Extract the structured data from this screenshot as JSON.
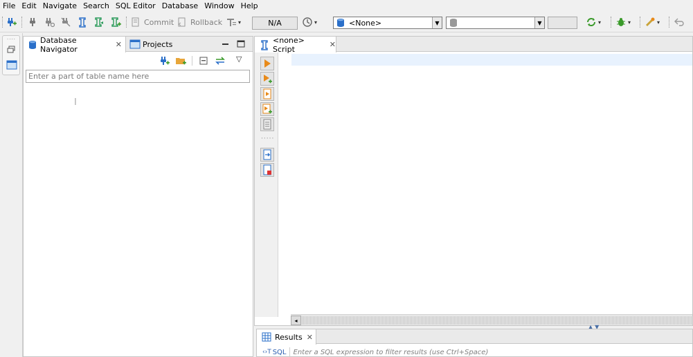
{
  "menu": [
    "File",
    "Edit",
    "Navigate",
    "Search",
    "SQL Editor",
    "Database",
    "Window",
    "Help"
  ],
  "toolbar": {
    "commit_label": "Commit",
    "rollback_label": "Rollback",
    "transaction_mode": "N/A",
    "datasource_combo": "<None>",
    "schema_combo": ""
  },
  "navigator": {
    "tabs": [
      {
        "label": "Database Navigator",
        "icon": "database-icon"
      },
      {
        "label": "Projects",
        "icon": "projects-icon"
      }
    ],
    "filter_placeholder": "Enter a part of table name here"
  },
  "editor": {
    "tab_label": "<none> Script"
  },
  "results": {
    "tab_label": "Results",
    "sql_label": "SQL",
    "filter_placeholder": "Enter a SQL expression to filter results (use Ctrl+Space)"
  },
  "colors": {
    "accent_green": "#3a9a2a",
    "accent_blue": "#2a6fc9",
    "accent_orange": "#e88a1a",
    "line_highlight": "#e8f2fe"
  }
}
